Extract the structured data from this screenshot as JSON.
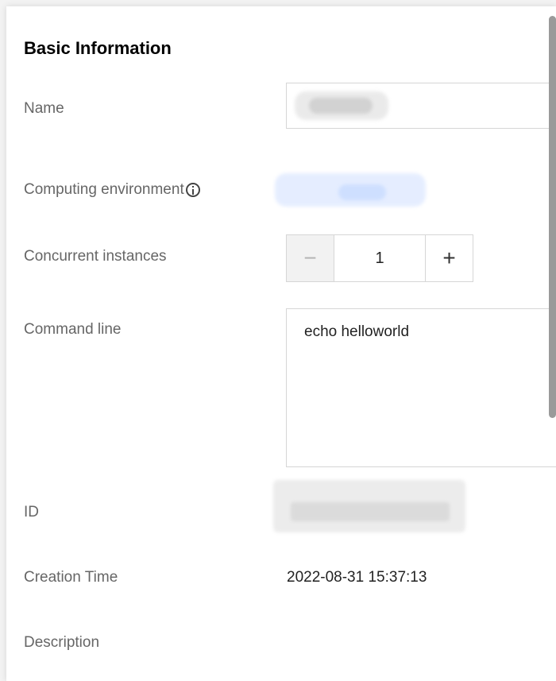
{
  "section": {
    "title": "Basic Information"
  },
  "fields": {
    "name_label": "Name",
    "env_label": "Computing environment",
    "instances_label": "Concurrent instances",
    "instances_value": "1",
    "minus_label": "−",
    "plus_label": "+",
    "command_label": "Command line",
    "command_value": "echo helloworld",
    "id_label": "ID",
    "creation_label": "Creation Time",
    "creation_value": "2022-08-31 15:37:13",
    "description_label": "Description"
  },
  "icons": {
    "env_help": "info-icon"
  }
}
